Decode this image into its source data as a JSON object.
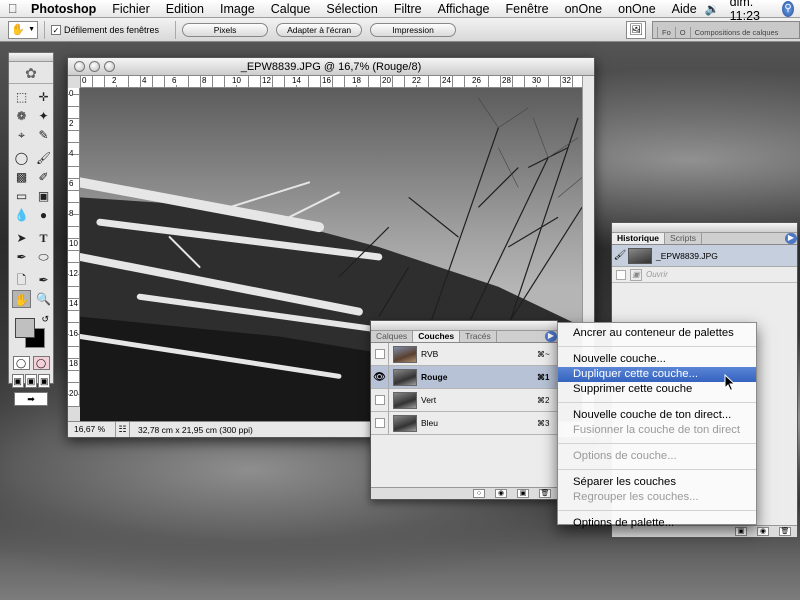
{
  "menubar": {
    "app": "Photoshop",
    "items": [
      "Fichier",
      "Edition",
      "Image",
      "Calque",
      "Sélection",
      "Filtre",
      "Affichage",
      "Fenêtre",
      "onOne",
      "onOne",
      "Aide"
    ],
    "clock": "dim. 11:23",
    "icons": [
      "apple-icon",
      "volume-icon",
      "spotlight-icon"
    ]
  },
  "options": {
    "scroll_label": "Défilement des fenêtres",
    "scroll_checked": true,
    "buttons": [
      "Pixels",
      "Adapter à l'écran",
      "Impression"
    ],
    "dock_tabs": [
      "Fo",
      "O",
      "Compositions de calques"
    ]
  },
  "document": {
    "title": "_EPW8839.JPG @ 16,7% (Rouge/8)",
    "zoom": "16,67 %",
    "info": "32,78 cm x 21,95 cm (300 ppi)",
    "ruler_h": [
      "0",
      "2",
      "4",
      "6",
      "8",
      "10",
      "12",
      "14",
      "16",
      "18",
      "20",
      "22",
      "24",
      "26",
      "28",
      "30",
      "32"
    ],
    "ruler_v": [
      "0",
      "2",
      "4",
      "6",
      "8",
      "10",
      "12",
      "14",
      "16",
      "18",
      "20"
    ]
  },
  "channels": {
    "tabs": [
      "Calques",
      "Couches",
      "Tracés"
    ],
    "active_tab": 1,
    "rows": [
      {
        "name": "RVB",
        "shortcut": "⌘~",
        "visible": false,
        "selected": false
      },
      {
        "name": "Rouge",
        "shortcut": "⌘1",
        "visible": true,
        "selected": true
      },
      {
        "name": "Vert",
        "shortcut": "⌘2",
        "visible": false,
        "selected": false
      },
      {
        "name": "Bleu",
        "shortcut": "⌘3",
        "visible": false,
        "selected": false
      }
    ]
  },
  "history": {
    "tabs": [
      "Historique",
      "Scripts"
    ],
    "snapshot": "_EPW8839.JPG",
    "states": [
      "Ouvrir"
    ]
  },
  "popup": {
    "groups": [
      [
        {
          "label": "Ancrer au conteneur de palettes"
        }
      ],
      [
        {
          "label": "Nouvelle couche..."
        },
        {
          "label": "Dupliquer cette couche...",
          "highlight": true
        },
        {
          "label": "Supprimer cette couche"
        }
      ],
      [
        {
          "label": "Nouvelle couche de ton direct..."
        },
        {
          "label": "Fusionner la couche de ton direct",
          "disabled": true
        }
      ],
      [
        {
          "label": "Options de couche...",
          "disabled": true
        }
      ],
      [
        {
          "label": "Séparer les couches"
        },
        {
          "label": "Regrouper les couches...",
          "disabled": true
        }
      ],
      [
        {
          "label": "Options de palette..."
        }
      ]
    ]
  }
}
